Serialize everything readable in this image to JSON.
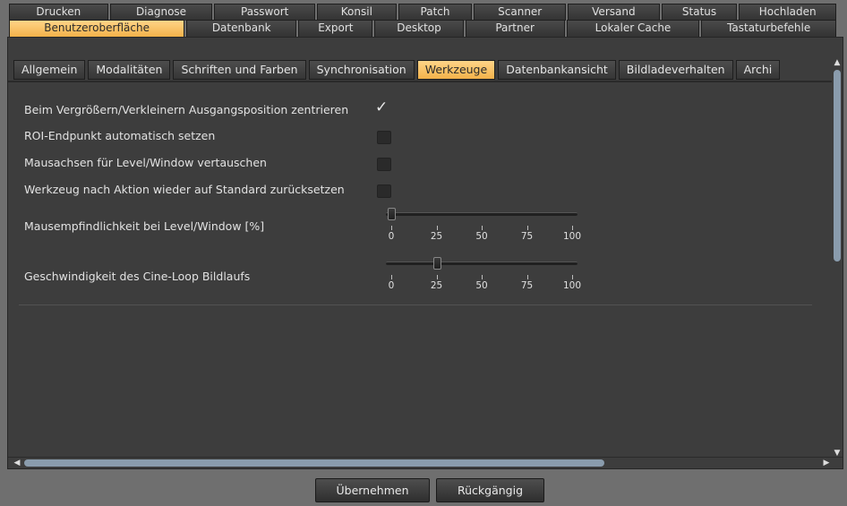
{
  "tabs_row1": [
    "Drucken",
    "Diagnose",
    "Passwort",
    "Konsil",
    "Patch",
    "Scanner",
    "Versand",
    "Status",
    "Hochladen"
  ],
  "tabs_row2": [
    "Benutzeroberfläche",
    "Datenbank",
    "Export",
    "Desktop",
    "Partner",
    "Lokaler Cache",
    "Tastaturbefehle"
  ],
  "tabs_row2_selected": "Benutzeroberfläche",
  "subtabs": [
    "Allgemein",
    "Modalitäten",
    "Schriften und Farben",
    "Synchronisation",
    "Werkzeuge",
    "Datenbankansicht",
    "Bildladeverhalten",
    "Archi"
  ],
  "subtabs_selected": "Werkzeuge",
  "settings": {
    "center_zoom": {
      "label": "Beim Vergrößern/Verkleinern Ausgangsposition zentrieren",
      "checked": true
    },
    "roi_endpoint": {
      "label": "ROI-Endpunkt automatisch setzen",
      "checked": false
    },
    "swap_mouse_axes": {
      "label": "Mausachsen für Level/Window vertauschen",
      "checked": false
    },
    "reset_tool": {
      "label": "Werkzeug nach Aktion wieder auf Standard zurücksetzen",
      "checked": false
    },
    "mouse_sensitivity": {
      "label": "Mausempfindlichkeit bei Level/Window [%]",
      "value": 0,
      "ticks": [
        "0",
        "25",
        "50",
        "75",
        "100"
      ]
    },
    "cine_speed": {
      "label": "Geschwindigkeit des Cine-Loop Bildlaufs",
      "value": 25,
      "ticks": [
        "0",
        "25",
        "50",
        "75",
        "100"
      ]
    }
  },
  "buttons": {
    "apply": "Übernehmen",
    "undo": "Rückgängig"
  }
}
